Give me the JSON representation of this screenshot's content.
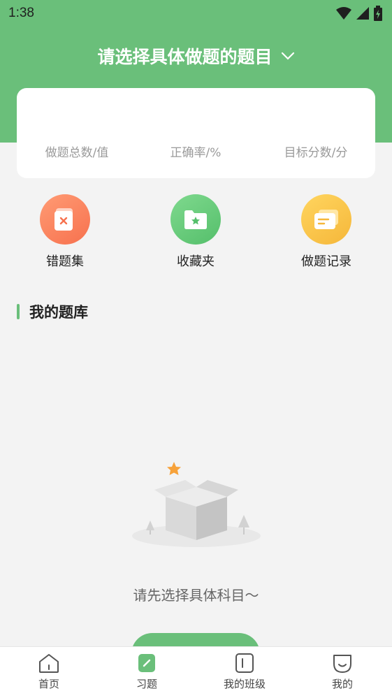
{
  "status_bar": {
    "time": "1:38"
  },
  "header": {
    "subject_title": "请选择具体做题的题目"
  },
  "stats": [
    {
      "label": "做题总数/值"
    },
    {
      "label": "正确率/%"
    },
    {
      "label": "目标分数/分"
    }
  ],
  "quick_actions": [
    {
      "label": "错题集",
      "icon": "wrong-set-icon",
      "color": "#f7714e"
    },
    {
      "label": "收藏夹",
      "icon": "favorites-icon",
      "color": "#55bf6b"
    },
    {
      "label": "做题记录",
      "icon": "record-icon",
      "color": "#f5b73a"
    }
  ],
  "section": {
    "title": "我的题库"
  },
  "empty_state": {
    "message": "请先选择具体科目～"
  },
  "bottom_nav": [
    {
      "label": "首页",
      "icon": "home-icon"
    },
    {
      "label": "习题",
      "icon": "exercise-icon",
      "active": true
    },
    {
      "label": "我的班级",
      "icon": "class-icon"
    },
    {
      "label": "我的",
      "icon": "profile-icon"
    }
  ],
  "colors": {
    "brand": "#6abf7a",
    "background": "#f3f3f3"
  }
}
